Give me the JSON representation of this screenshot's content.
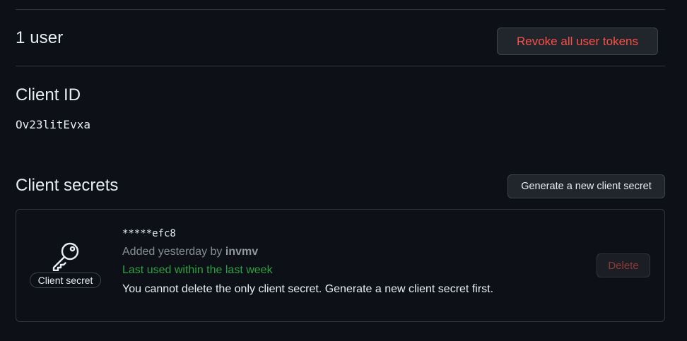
{
  "users": {
    "count": "1",
    "label": "user",
    "revoke_button_label": "Revoke all user tokens"
  },
  "client_id": {
    "title": "Client ID",
    "value": "Ov23litEvxa"
  },
  "client_secrets": {
    "title": "Client secrets",
    "generate_button_label": "Generate a new client secret",
    "items": [
      {
        "badge_label": "Client secret",
        "masked_value": "*****efc8",
        "added_prefix": "Added yesterday by",
        "added_by": "invmv",
        "last_used": "Last used within the last week",
        "note": "You cannot delete the only client secret. Generate a new client secret first.",
        "delete_label": "Delete",
        "icon": "key-icon"
      }
    ]
  },
  "colors": {
    "background": "#0d1117",
    "danger": "#f85149",
    "success": "#2ea043",
    "muted": "#848d97",
    "border": "#30363d"
  }
}
